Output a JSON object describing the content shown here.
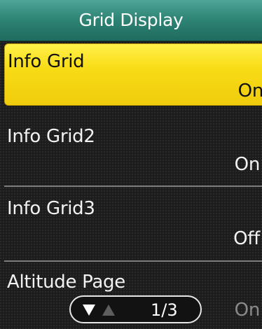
{
  "header": {
    "title": "Grid Display"
  },
  "items": [
    {
      "label": "Info Grid",
      "value": "On"
    },
    {
      "label": "Info Grid2",
      "value": "On"
    },
    {
      "label": "Info Grid3",
      "value": "Off"
    },
    {
      "label": "Altitude Page",
      "value": "On"
    }
  ],
  "pager": {
    "text": "1/3",
    "down_icon": "triangle-down-icon",
    "up_icon": "triangle-up-icon"
  },
  "colors": {
    "header_top": "#4fa698",
    "header_bottom": "#1f6b5e",
    "selected_highlight": "#f8dc16",
    "background": "#1c1c1c"
  }
}
